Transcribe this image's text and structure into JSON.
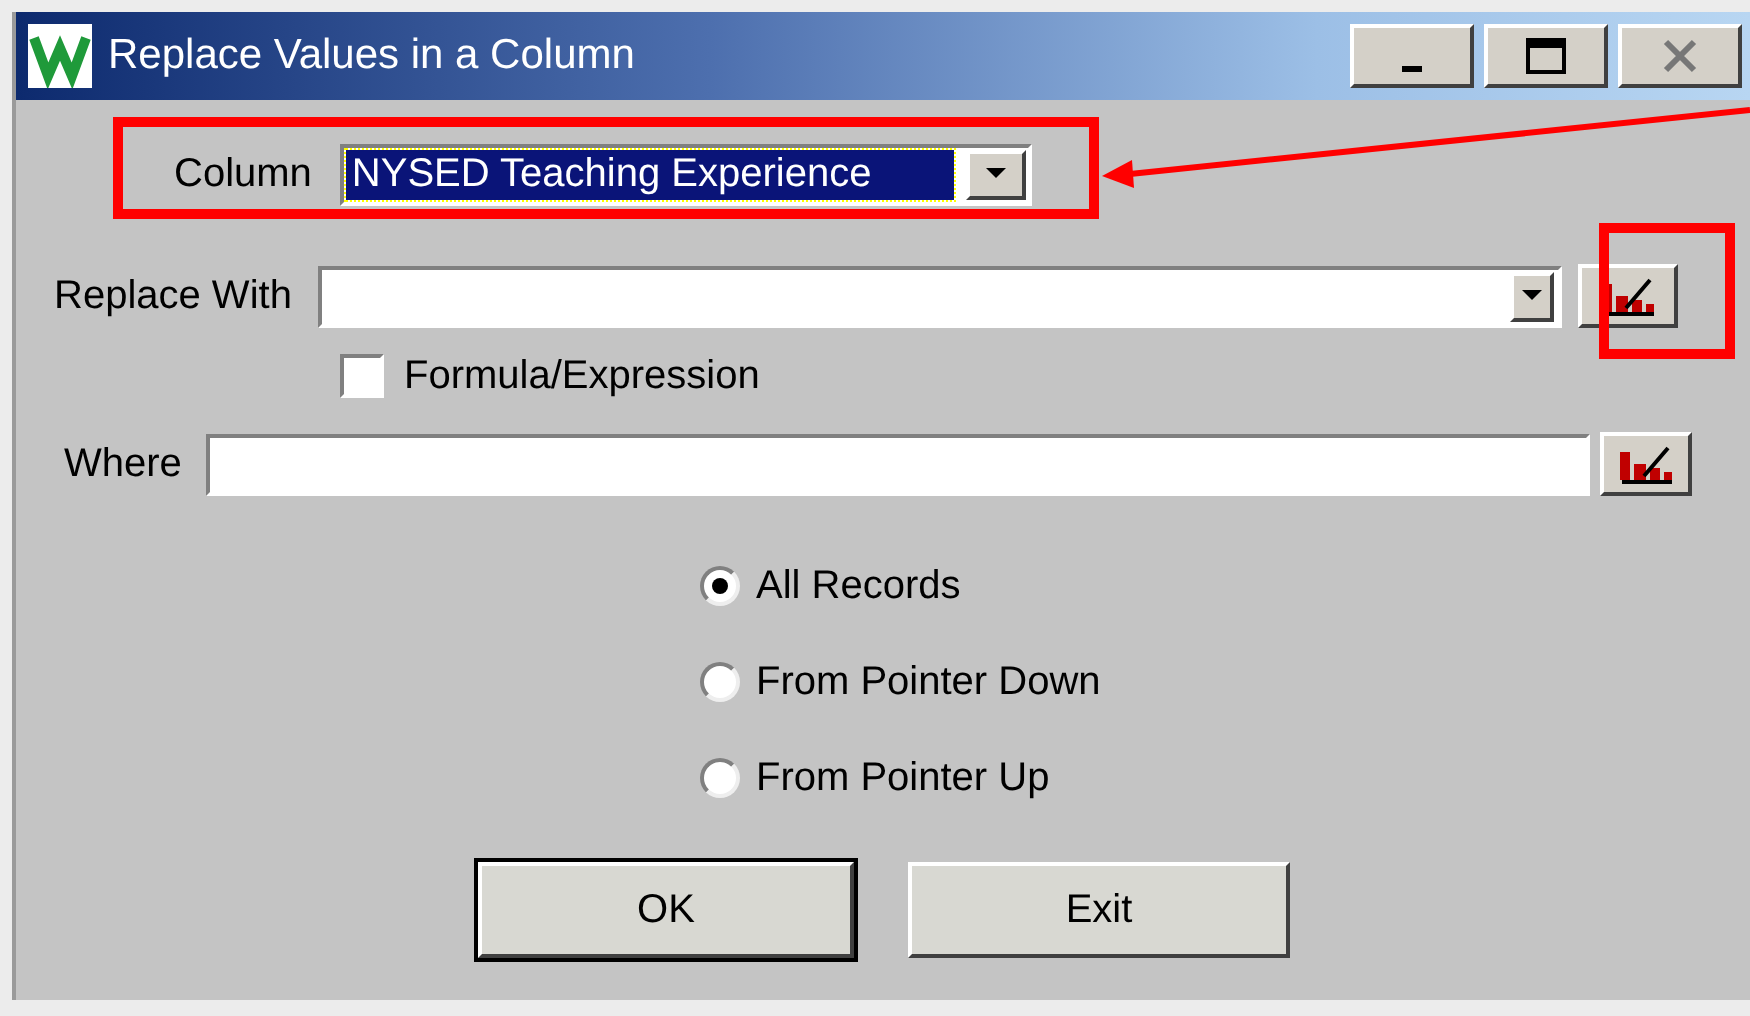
{
  "window": {
    "title": "Replace Values in a Column"
  },
  "column": {
    "label": "Column",
    "value": "NYSED Teaching Experience"
  },
  "replace_with": {
    "label": "Replace With"
  },
  "formula": {
    "label": "Formula/Expression",
    "checked": false
  },
  "where": {
    "label": "Where"
  },
  "scope": [
    {
      "label": "All Records",
      "selected": true
    },
    {
      "label": "From Pointer Down",
      "selected": false
    },
    {
      "label": "From Pointer Up",
      "selected": false
    }
  ],
  "buttons": [
    {
      "label": "OK",
      "default": true
    },
    {
      "label": "Exit",
      "default": false
    }
  ]
}
